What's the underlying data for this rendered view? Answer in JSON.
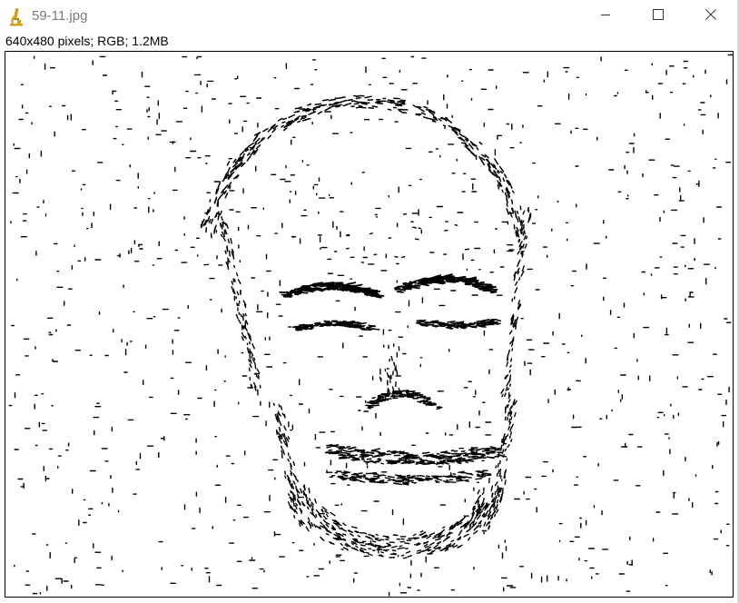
{
  "window": {
    "title": "59-11.jpg",
    "controls": {
      "minimize": "minimize",
      "maximize": "maximize",
      "close": "close"
    }
  },
  "image_info": "640x480 pixels; RGB; 1.2MB",
  "image": {
    "content": "edge-detected face",
    "colors": {
      "background": "#ffffff",
      "ink": "#000000",
      "icon_accent": "#d4a017"
    }
  }
}
